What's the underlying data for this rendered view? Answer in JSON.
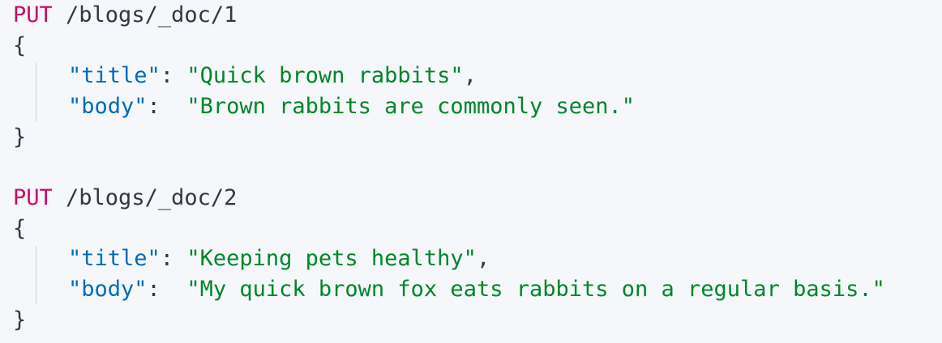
{
  "requests": [
    {
      "method": "PUT",
      "path": " /blogs/_doc/1",
      "open_brace": "{",
      "close_brace": "}",
      "fields": [
        {
          "key": "\"title\"",
          "sep": ": ",
          "value": "\"Quick brown rabbits\"",
          "trail": ","
        },
        {
          "key": "\"body\"",
          "sep": ":  ",
          "value": "\"Brown rabbits are commonly seen.\"",
          "trail": ""
        }
      ]
    },
    {
      "method": "PUT",
      "path": " /blogs/_doc/2",
      "open_brace": "{",
      "close_brace": "}",
      "fields": [
        {
          "key": "\"title\"",
          "sep": ": ",
          "value": "\"Keeping pets healthy\"",
          "trail": ","
        },
        {
          "key": "\"body\"",
          "sep": ":  ",
          "value": "\"My quick brown fox eats rabbits on a regular basis.\"",
          "trail": ""
        }
      ]
    }
  ],
  "colors": {
    "background": "#f5f7fa",
    "method": "#c80a68",
    "key": "#006bb8",
    "string": "#00852b",
    "text": "#343741",
    "guide": "#c9ced6"
  }
}
